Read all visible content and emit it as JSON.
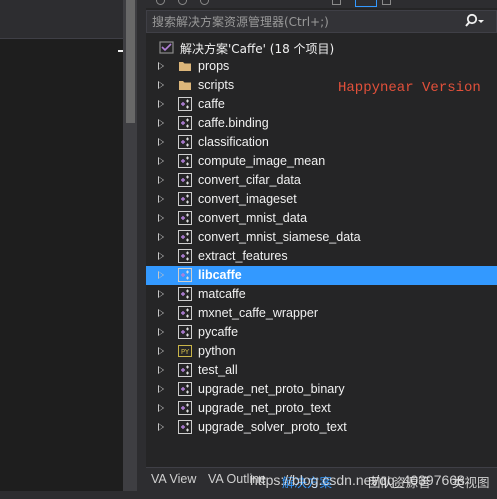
{
  "search": {
    "placeholder": "搜索解决方案资源管理器(Ctrl+;)"
  },
  "solution": {
    "label": "解决方案'Caffe' (18 个项目)"
  },
  "items": [
    {
      "label": "props",
      "kind": "folder"
    },
    {
      "label": "scripts",
      "kind": "folder"
    },
    {
      "label": "caffe",
      "kind": "project"
    },
    {
      "label": "caffe.binding",
      "kind": "project"
    },
    {
      "label": "classification",
      "kind": "project"
    },
    {
      "label": "compute_image_mean",
      "kind": "project"
    },
    {
      "label": "convert_cifar_data",
      "kind": "project"
    },
    {
      "label": "convert_imageset",
      "kind": "project"
    },
    {
      "label": "convert_mnist_data",
      "kind": "project"
    },
    {
      "label": "convert_mnist_siamese_data",
      "kind": "project"
    },
    {
      "label": "extract_features",
      "kind": "project"
    },
    {
      "label": "libcaffe",
      "kind": "project",
      "selected": true
    },
    {
      "label": "matcaffe",
      "kind": "project"
    },
    {
      "label": "mxnet_caffe_wrapper",
      "kind": "project"
    },
    {
      "label": "pycaffe",
      "kind": "project"
    },
    {
      "label": "python",
      "kind": "python"
    },
    {
      "label": "test_all",
      "kind": "project"
    },
    {
      "label": "upgrade_net_proto_binary",
      "kind": "project"
    },
    {
      "label": "upgrade_net_proto_text",
      "kind": "project"
    },
    {
      "label": "upgrade_solver_proto_text",
      "kind": "project"
    }
  ],
  "watermark": {
    "version": "Happynear Version",
    "url": "https://blog.csdn.net/qq_40397668"
  },
  "bottom_tabs": [
    {
      "label": "VA View",
      "active": false
    },
    {
      "label": "VA Outline",
      "active": false
    },
    {
      "label": "解决方案",
      "active": true
    },
    {
      "label": "团队资源管",
      "active": false
    },
    {
      "label": "类视图",
      "active": false
    }
  ],
  "colors": {
    "selection": "#3399ff",
    "background": "#252526",
    "folder": "#dcb67a",
    "project_icon": "#b180d7",
    "python_icon": "#c9b54a",
    "watermark_version": "#e2503a"
  }
}
